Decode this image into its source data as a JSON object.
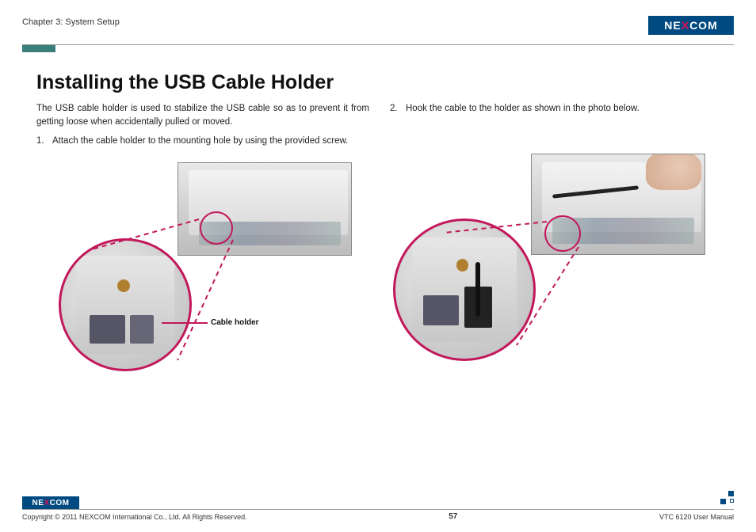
{
  "header": {
    "chapter": "Chapter 3: System Setup",
    "logo_text_pre": "NE",
    "logo_text_x": "X",
    "logo_text_post": "COM"
  },
  "title": "Installing the USB Cable Holder",
  "left": {
    "intro": "The USB cable holder is used to stabilize the USB cable so as to prevent it from getting loose when accidentally pulled or moved.",
    "step_num": "1.",
    "step_text": "Attach the cable holder to the mounting hole by using the provided screw.",
    "callout": "Cable holder"
  },
  "right": {
    "step_num": "2.",
    "step_text": "Hook the cable to the holder as shown in the photo below."
  },
  "footer": {
    "copyright": "Copyright © 2011 NEXCOM International Co., Ltd. All Rights Reserved.",
    "page": "57",
    "manual": "VTC 6120 User Manual",
    "logo_text_pre": "NE",
    "logo_text_x": "X",
    "logo_text_post": "COM"
  }
}
